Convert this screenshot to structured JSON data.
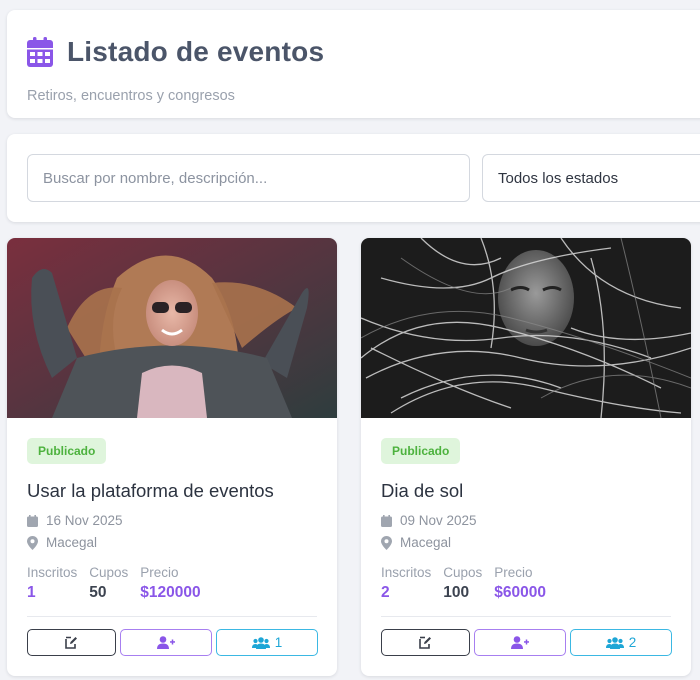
{
  "header": {
    "title": "Listado de eventos",
    "subtitle": "Retiros, encuentros y congresos",
    "icon": "calendar-icon",
    "accent_color": "#8a56e8"
  },
  "filters": {
    "search_placeholder": "Buscar por nombre, descripción...",
    "status_selected": "Todos los estados"
  },
  "events": [
    {
      "status": "Publicado",
      "title": "Usar la plataforma de eventos",
      "date": "16 Nov 2025",
      "location": "Macegal",
      "stats": {
        "inscritos_label": "Inscritos",
        "inscritos": "1",
        "cupos_label": "Cupos",
        "cupos": "50",
        "precio_label": "Precio",
        "precio": "$120000"
      },
      "attendees_count": "1"
    },
    {
      "status": "Publicado",
      "title": "Dia de sol",
      "date": "09 Nov 2025",
      "location": "Macegal",
      "stats": {
        "inscritos_label": "Inscritos",
        "inscritos": "2",
        "cupos_label": "Cupos",
        "cupos": "100",
        "precio_label": "Precio",
        "precio": "$60000"
      },
      "attendees_count": "2"
    }
  ],
  "colors": {
    "status_published_bg": "#dff5dc",
    "status_published_text": "#4db23e",
    "edit_border": "#3a3f4a",
    "add_border": "#a77ff0",
    "people_border": "#3bb8e3"
  }
}
